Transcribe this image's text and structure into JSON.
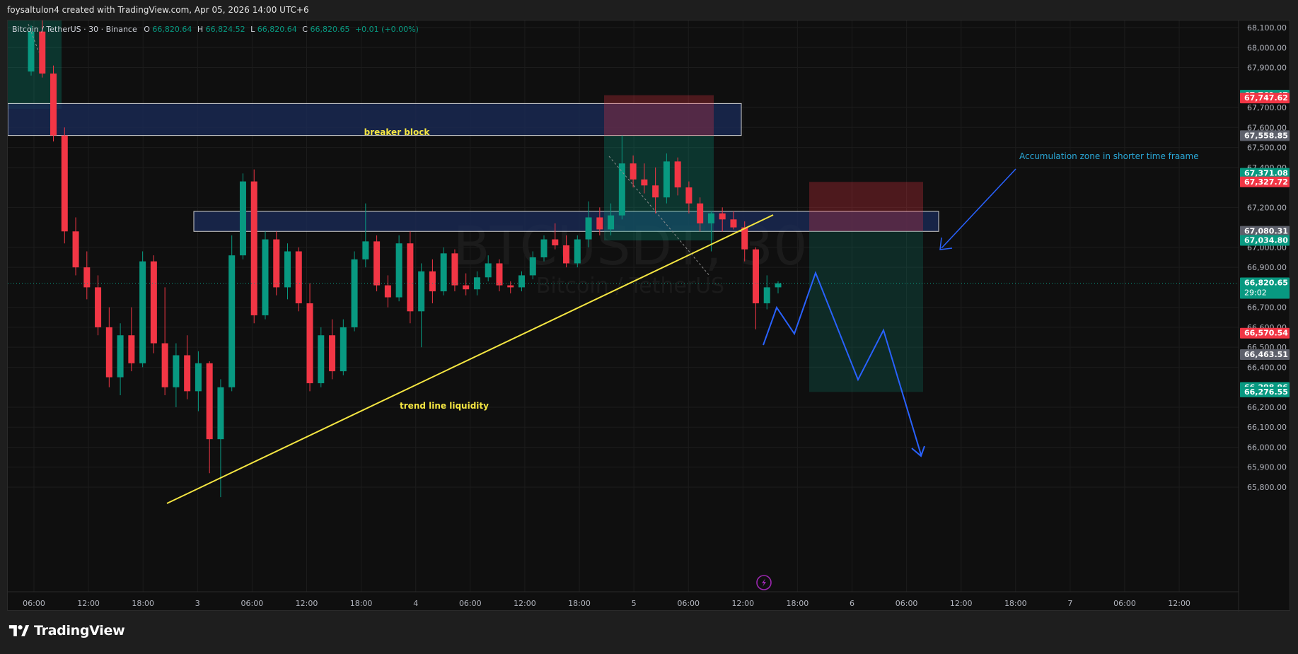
{
  "header": {
    "attribution": "foysaltulon4 created with TradingView.com, Apr 05, 2026 14:00 UTC+6"
  },
  "legend": {
    "symbol": "Bitcoin / TetherUS · 30 · Binance",
    "o_label": "O",
    "o_value": "66,820.64",
    "h_label": "H",
    "h_value": "66,824.52",
    "l_label": "L",
    "l_value": "66,820.64",
    "c_label": "C",
    "c_value": "66,820.65",
    "change": "+0.01 (+0.00%)"
  },
  "watermark": {
    "main": "BTCUSDT, 30",
    "sub": "Bitcoin / TetherUS"
  },
  "footer": {
    "brand": "TradingView"
  },
  "colors": {
    "up": "#089981",
    "down": "#f23645",
    "trendline": "#f5e642",
    "arrow": "#2962ff",
    "zone_fill": "#1a2a55",
    "annotation_text": "#f5e642",
    "accumulation_text": "#2aa7d6"
  },
  "chart_data": {
    "type": "candlestick",
    "symbol": "BTCUSDT",
    "timeframe": "30",
    "ylim": [
      65700,
      68150
    ],
    "y_ticks": [
      "68,100.00",
      "68,000.00",
      "67,900.00",
      "67,700.00",
      "67,600.00",
      "67,500.00",
      "67,400.00",
      "67,200.00",
      "67,000.00",
      "66,900.00",
      "66,700.00",
      "66,600.00",
      "66,500.00",
      "66,400.00",
      "66,200.00",
      "66,100.00",
      "66,000.00",
      "65,900.00",
      "65,800.00"
    ],
    "x_ticks": [
      "06:00",
      "12:00",
      "18:00",
      "3",
      "06:00",
      "12:00",
      "18:00",
      "4",
      "06:00",
      "12:00",
      "18:00",
      "5",
      "06:00",
      "12:00",
      "18:00",
      "6",
      "06:00",
      "12:00",
      "18:00",
      "7",
      "06:00",
      "12:00"
    ],
    "price_labels": [
      {
        "text": "67,761.47",
        "value": 67761.47,
        "color": "#089981"
      },
      {
        "text": "67,747.62",
        "value": 67747.62,
        "color": "#f23645"
      },
      {
        "text": "67,558.85",
        "value": 67558.85,
        "color": "#5d606b"
      },
      {
        "text": "67,371.08",
        "value": 67371.08,
        "color": "#089981"
      },
      {
        "text": "67,327.72",
        "value": 67327.72,
        "color": "#f23645"
      },
      {
        "text": "67,080.31",
        "value": 67080.31,
        "color": "#5d606b"
      },
      {
        "text": "67,034.80",
        "value": 67034.8,
        "color": "#089981"
      },
      {
        "text": "66,820.65",
        "value": 66820.65,
        "color": "#089981",
        "sub": "29:02"
      },
      {
        "text": "66,570.54",
        "value": 66570.54,
        "color": "#f23645"
      },
      {
        "text": "66,463.51",
        "value": 66463.51,
        "color": "#5d606b"
      },
      {
        "text": "66,298.96",
        "value": 66298.96,
        "color": "#089981"
      },
      {
        "text": "66,276.55",
        "value": 66276.55,
        "color": "#089981"
      }
    ],
    "candles": [
      [
        67880,
        68110,
        67860,
        68080
      ],
      [
        68080,
        68140,
        67850,
        67870
      ],
      [
        67870,
        67910,
        67530,
        67560
      ],
      [
        67560,
        67600,
        67020,
        67080
      ],
      [
        67080,
        67150,
        66860,
        66900
      ],
      [
        66900,
        66980,
        66740,
        66800
      ],
      [
        66800,
        66860,
        66560,
        66600
      ],
      [
        66600,
        66700,
        66300,
        66350
      ],
      [
        66350,
        66620,
        66260,
        66560
      ],
      [
        66560,
        66700,
        66380,
        66420
      ],
      [
        66420,
        66980,
        66400,
        66930
      ],
      [
        66930,
        66960,
        66470,
        66520
      ],
      [
        66520,
        66800,
        66260,
        66300
      ],
      [
        66300,
        66520,
        66200,
        66460
      ],
      [
        66460,
        66560,
        66240,
        66280
      ],
      [
        66280,
        66480,
        66180,
        66420
      ],
      [
        66420,
        66430,
        65870,
        66040
      ],
      [
        66040,
        66340,
        65750,
        66300
      ],
      [
        66300,
        67060,
        66280,
        66960
      ],
      [
        66960,
        67370,
        66940,
        67330
      ],
      [
        67330,
        67390,
        66620,
        66660
      ],
      [
        66660,
        67080,
        66640,
        67040
      ],
      [
        67040,
        67080,
        66760,
        66800
      ],
      [
        66800,
        67020,
        66740,
        66980
      ],
      [
        66980,
        67000,
        66680,
        66720
      ],
      [
        66720,
        66820,
        66280,
        66320
      ],
      [
        66320,
        66600,
        66300,
        66560
      ],
      [
        66560,
        66640,
        66340,
        66380
      ],
      [
        66380,
        66640,
        66360,
        66600
      ],
      [
        66600,
        66980,
        66580,
        66940
      ],
      [
        66940,
        67220,
        66900,
        67030
      ],
      [
        67030,
        67060,
        66780,
        66810
      ],
      [
        66810,
        66860,
        66700,
        66750
      ],
      [
        66750,
        67060,
        66730,
        67020
      ],
      [
        67020,
        67080,
        66620,
        66680
      ],
      [
        66680,
        66920,
        66500,
        66880
      ],
      [
        66880,
        66940,
        66720,
        66780
      ],
      [
        66780,
        67000,
        66760,
        66970
      ],
      [
        66970,
        66990,
        66780,
        66810
      ],
      [
        66810,
        66870,
        66760,
        66790
      ],
      [
        66790,
        66880,
        66760,
        66850
      ],
      [
        66850,
        66960,
        66830,
        66920
      ],
      [
        66920,
        66940,
        66780,
        66810
      ],
      [
        66810,
        66830,
        66770,
        66800
      ],
      [
        66800,
        66880,
        66780,
        66860
      ],
      [
        66860,
        66980,
        66840,
        66950
      ],
      [
        66950,
        67060,
        66930,
        67040
      ],
      [
        67040,
        67120,
        66990,
        67010
      ],
      [
        67010,
        67060,
        66900,
        66920
      ],
      [
        66920,
        67060,
        66900,
        67040
      ],
      [
        67040,
        67230,
        67000,
        67150
      ],
      [
        67150,
        67200,
        67060,
        67090
      ],
      [
        67090,
        67220,
        67060,
        67160
      ],
      [
        67160,
        67560,
        67140,
        67420
      ],
      [
        67420,
        67460,
        67300,
        67340
      ],
      [
        67340,
        67420,
        67270,
        67310
      ],
      [
        67310,
        67400,
        67170,
        67250
      ],
      [
        67250,
        67470,
        67220,
        67430
      ],
      [
        67430,
        67450,
        67260,
        67300
      ],
      [
        67300,
        67330,
        67170,
        67220
      ],
      [
        67220,
        67250,
        67080,
        67120
      ],
      [
        67120,
        67180,
        66980,
        67170
      ],
      [
        67170,
        67200,
        67080,
        67140
      ],
      [
        67140,
        67180,
        67090,
        67100
      ],
      [
        67100,
        67130,
        66930,
        66990
      ],
      [
        66990,
        67000,
        66590,
        66720
      ],
      [
        66720,
        66860,
        66690,
        66800
      ],
      [
        66800,
        66830,
        66770,
        66820
      ]
    ],
    "last_price": 66820.65,
    "zones": [
      {
        "label": "breaker block",
        "from": 67560,
        "to": 67720
      },
      {
        "label": "",
        "from": 67080,
        "to": 67180
      }
    ],
    "annotations": [
      {
        "text": "breaker block"
      },
      {
        "text": "trend line liquidity"
      },
      {
        "text": "Accumulation zone in shorter time fraame"
      }
    ],
    "grid": true
  }
}
